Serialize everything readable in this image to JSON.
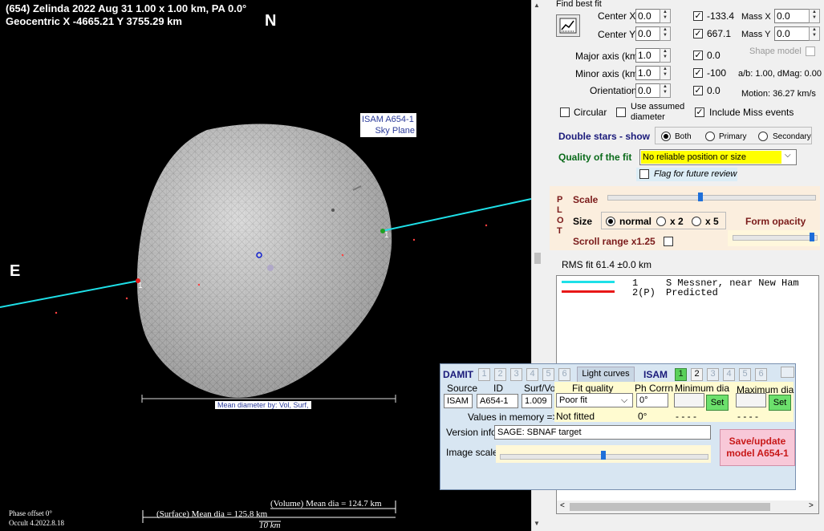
{
  "plot": {
    "header_line1": "(654) Zelinda  2022 Aug 31   1.00 x 1.00 km,  PA 0.0°",
    "header_line2": "Geocentric  X  -4665.21  Y 3755.29 km",
    "north": "N",
    "east": "E",
    "isam_label_line1": "ISAM A654-1",
    "isam_label_line2": "Sky Plane",
    "mean_diameter_by": "Mean diameter by:  Vol,  Surf,",
    "chord1_label": "1",
    "chord2_label": "1",
    "volume_mean": "(Volume) Mean dia = 124.7 km",
    "surface_mean": "(Surface) Mean dia = 125.8 km",
    "scale_10km": "10 km",
    "phase_offset": "Phase offset 0°",
    "version": "Occult 4.2022.8.18",
    "colors": {
      "chord": "#1ee0e8",
      "asteroid": "#c8c8c8",
      "background": "#000000"
    }
  },
  "fit": {
    "find_best_fit": "Find best fit",
    "center_x_label": "Center X",
    "center_x_value": "0.0",
    "center_x_result": "-133.4",
    "center_y_label": "Center Y",
    "center_y_value": "0.0",
    "center_y_result": "667.1",
    "mass_x_label": "Mass X",
    "mass_x_value": "0.0",
    "mass_y_label": "Mass Y",
    "mass_y_value": "0.0",
    "major_axis_label": "Major axis (km)",
    "major_axis_value": "1.0",
    "major_axis_result": "0.0",
    "minor_axis_label": "Minor axis (km)",
    "minor_axis_value": "1.0",
    "minor_axis_result": "-100",
    "orientation_label": "Orientation",
    "orientation_value": "0.0",
    "orientation_result": "0.0",
    "shape_model": "Shape model",
    "ab_dmag": "a/b: 1.00, dMag: 0.00",
    "motion": "Motion: 36.27 km/s",
    "circular": "Circular",
    "use_assumed_line1": "Use assumed",
    "use_assumed_line2": "diameter",
    "include_miss": "Include Miss events",
    "double_stars": "Double stars - show",
    "both": "Both",
    "primary": "Primary",
    "secondary": "Secondary",
    "quality_label": "Quality of the fit",
    "quality_value": "No reliable position or size",
    "flag_review": "Flag for future review"
  },
  "plot_controls": {
    "vertical_label": [
      "P",
      "L",
      "O",
      "T"
    ],
    "scale": "Scale",
    "size": "Size",
    "normal": "normal",
    "x2": "x 2",
    "x5": "x 5",
    "form_opacity": "Form opacity",
    "scroll_range": "Scroll range x1.25",
    "scale_slider": 0.45,
    "opacity_slider": 0.95
  },
  "rms": "RMS fit 61.4 ±0.0 km",
  "legend": [
    {
      "num": "1",
      "text": "S Messner, near New Ham",
      "color": "#1ee0e8"
    },
    {
      "num": "2(P)",
      "text": "Predicted",
      "color": "#e81818"
    }
  ],
  "damit": {
    "title": "DAMIT",
    "damit_tabs": [
      "1",
      "2",
      "3",
      "4",
      "5",
      "6"
    ],
    "light_curves": "Light curves",
    "isam": "ISAM",
    "isam_tabs": [
      "1",
      "2",
      "3",
      "4",
      "5",
      "6"
    ],
    "source_label": "Source",
    "id_label": "ID",
    "surf_vol_label": "Surf/Vol",
    "source_value": "ISAM",
    "id_value": "A654-1",
    "surf_vol_value": "1.009",
    "values_in_memory": "Values in memory =>",
    "fit_quality_label": "Fit quality",
    "fit_quality_value": "Poor fit",
    "fit_quality_memory": "Not fitted",
    "ph_corrn_label": "Ph Corrn",
    "ph_corrn_value": "0°",
    "ph_corrn_memory": "0°",
    "min_dia_label": "Minimum dia",
    "min_dia_memory": "- - - -",
    "max_dia_label": "Maximum dia",
    "max_dia_memory": "- - - -",
    "set": "Set",
    "version_info_label": "Version info",
    "version_info_value": "SAGE: SBNAF target",
    "image_scale_label": "Image scale",
    "image_scale_slider": 0.5,
    "save_line1": "Save/update",
    "save_line2": "model A654-1"
  }
}
